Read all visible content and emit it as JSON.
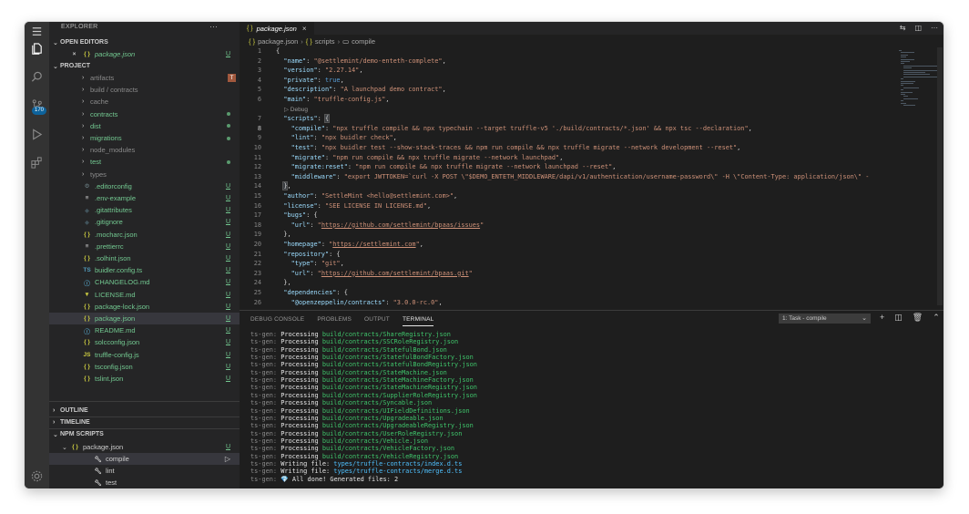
{
  "sidebar": {
    "title": "EXPLORER",
    "open_editors": {
      "label": "OPEN EDITORS",
      "files": [
        {
          "name": "package.json",
          "icon": "{ }",
          "status": "U"
        }
      ]
    },
    "project": {
      "label": "PROJECT",
      "items": [
        {
          "name": "artifacts",
          "kind": "folder",
          "status": "T",
          "color": "gray"
        },
        {
          "name": "build / contracts",
          "kind": "folder",
          "status": "",
          "color": "gray"
        },
        {
          "name": "cache",
          "kind": "folder",
          "status": "",
          "color": "gray"
        },
        {
          "name": "contracts",
          "kind": "folder",
          "status": "dot",
          "color": "green"
        },
        {
          "name": "dist",
          "kind": "folder",
          "status": "dot",
          "color": "green"
        },
        {
          "name": "migrations",
          "kind": "folder",
          "status": "dot",
          "color": "green"
        },
        {
          "name": "node_modules",
          "kind": "folder",
          "status": "",
          "color": "gray"
        },
        {
          "name": "test",
          "kind": "folder",
          "status": "dot",
          "color": "green"
        },
        {
          "name": "types",
          "kind": "folder",
          "status": "",
          "color": "gray"
        },
        {
          "name": ".editorconfig",
          "icon": "⚙",
          "status": "U",
          "color": "green",
          "iconColor": "#6d8086"
        },
        {
          "name": ".env-example",
          "icon": "≡",
          "status": "U",
          "color": "green",
          "iconColor": "#cccccc"
        },
        {
          "name": ".gitattributes",
          "icon": "◆",
          "status": "U",
          "color": "green",
          "iconColor": "#41535b"
        },
        {
          "name": ".gitignore",
          "icon": "◆",
          "status": "U",
          "color": "green",
          "iconColor": "#41535b"
        },
        {
          "name": ".mocharc.json",
          "icon": "{ }",
          "status": "U",
          "color": "green",
          "iconColor": "#cbcb41"
        },
        {
          "name": ".prettierrc",
          "icon": "≡",
          "status": "U",
          "color": "green",
          "iconColor": "#cccccc"
        },
        {
          "name": ".solhint.json",
          "icon": "{ }",
          "status": "U",
          "color": "green",
          "iconColor": "#cbcb41"
        },
        {
          "name": "buidler.config.ts",
          "icon": "TS",
          "status": "U",
          "color": "green",
          "iconColor": "#519aba"
        },
        {
          "name": "CHANGELOG.md",
          "icon": "ⓘ",
          "status": "U",
          "color": "green",
          "iconColor": "#519aba"
        },
        {
          "name": "LICENSE.md",
          "icon": "▼",
          "status": "U",
          "color": "green",
          "iconColor": "#cbcb41"
        },
        {
          "name": "package-lock.json",
          "icon": "{ }",
          "status": "U",
          "color": "green",
          "iconColor": "#cbcb41"
        },
        {
          "name": "package.json",
          "icon": "{ }",
          "status": "U",
          "color": "green",
          "iconColor": "#cbcb41",
          "selected": true
        },
        {
          "name": "README.md",
          "icon": "ⓘ",
          "status": "U",
          "color": "green",
          "iconColor": "#519aba"
        },
        {
          "name": "solcconfig.json",
          "icon": "{ }",
          "status": "U",
          "color": "green",
          "iconColor": "#cbcb41"
        },
        {
          "name": "truffle-config.js",
          "icon": "JS",
          "status": "U",
          "color": "green",
          "iconColor": "#cbcb41"
        },
        {
          "name": "tsconfig.json",
          "icon": "{ }",
          "status": "U",
          "color": "green",
          "iconColor": "#cbcb41"
        },
        {
          "name": "tslint.json",
          "icon": "{ }",
          "status": "U",
          "color": "green",
          "iconColor": "#cbcb41"
        }
      ]
    },
    "outline_label": "OUTLINE",
    "timeline_label": "TIMELINE",
    "npm_scripts": {
      "label": "NPM SCRIPTS",
      "file": "package.json",
      "file_status": "U",
      "scripts": [
        "compile",
        "lint",
        "test"
      ]
    },
    "scm_badge": "170"
  },
  "editor": {
    "tab_title": "package.json",
    "breadcrumb": [
      "package.json",
      "scripts",
      "compile"
    ],
    "debug_lens": "▷ Debug",
    "lines": [
      "{",
      "  \"name\": \"@settlemint/demo-enteth-complete\",",
      "  \"version\": \"2.27.14\",",
      "  \"private\": true,",
      "  \"description\": \"A launchpad demo contract\",",
      "  \"main\": \"truffle-config.js\",",
      "  \"scripts\": {",
      "    \"compile\": \"npx truffle compile && npx typechain --target truffle-v5 './build/contracts/*.json' && npx tsc --declaration\",",
      "    \"lint\": \"npx buidler check\",",
      "    \"test\": \"npx buidler test --show-stack-traces && npm run compile && npx truffle migrate --network development --reset\",",
      "    \"migrate\": \"npm run compile && npx truffle migrate --network launchpad\",",
      "    \"migrate:reset\": \"npm run compile && npx truffle migrate --network launchpad --reset\",",
      "    \"middleware\": \"export JWTTOKEN=`curl -X POST \\\"$DEMO_ENTETH_MIDDLEWARE/dapi/v1/authentication/username-password\\\" -H \\\"Content-Type: application/json\\\" -",
      "  },",
      "  \"author\": \"SettleMint <hello@settlemint.com>\",",
      "  \"license\": \"SEE LICENSE IN LICENSE.md\",",
      "  \"bugs\": {",
      "    \"url\": \"https://github.com/settlemint/bpaas/issues\"",
      "  },",
      "  \"homepage\": \"https://settlemint.com\",",
      "  \"repository\": {",
      "    \"type\": \"git\",",
      "    \"url\": \"https://github.com/settlemint/bpaas.git\"",
      "  },",
      "  \"dependencies\": {",
      "    \"@openzeppelin/contracts\": \"3.0.0-rc.0\","
    ],
    "current_line": 8
  },
  "panel": {
    "tabs": [
      "DEBUG CONSOLE",
      "PROBLEMS",
      "OUTPUT",
      "TERMINAL"
    ],
    "active_tab": "TERMINAL",
    "task_selector": "1: Task - compile",
    "terminal": [
      {
        "prefix": "ts-gen:",
        "verb": "Processing",
        "path": "build/contracts/ShareRegistry.json"
      },
      {
        "prefix": "ts-gen:",
        "verb": "Processing",
        "path": "build/contracts/SSCRoleRegistry.json"
      },
      {
        "prefix": "ts-gen:",
        "verb": "Processing",
        "path": "build/contracts/StatefulBond.json"
      },
      {
        "prefix": "ts-gen:",
        "verb": "Processing",
        "path": "build/contracts/StatefulBondFactory.json"
      },
      {
        "prefix": "ts-gen:",
        "verb": "Processing",
        "path": "build/contracts/StatefulBondRegistry.json"
      },
      {
        "prefix": "ts-gen:",
        "verb": "Processing",
        "path": "build/contracts/StateMachine.json"
      },
      {
        "prefix": "ts-gen:",
        "verb": "Processing",
        "path": "build/contracts/StateMachineFactory.json"
      },
      {
        "prefix": "ts-gen:",
        "verb": "Processing",
        "path": "build/contracts/StateMachineRegistry.json"
      },
      {
        "prefix": "ts-gen:",
        "verb": "Processing",
        "path": "build/contracts/SupplierRoleRegistry.json"
      },
      {
        "prefix": "ts-gen:",
        "verb": "Processing",
        "path": "build/contracts/Syncable.json"
      },
      {
        "prefix": "ts-gen:",
        "verb": "Processing",
        "path": "build/contracts/UIFieldDefinitions.json"
      },
      {
        "prefix": "ts-gen:",
        "verb": "Processing",
        "path": "build/contracts/Upgradeable.json"
      },
      {
        "prefix": "ts-gen:",
        "verb": "Processing",
        "path": "build/contracts/UpgradeableRegistry.json"
      },
      {
        "prefix": "ts-gen:",
        "verb": "Processing",
        "path": "build/contracts/UserRoleRegistry.json"
      },
      {
        "prefix": "ts-gen:",
        "verb": "Processing",
        "path": "build/contracts/Vehicle.json"
      },
      {
        "prefix": "ts-gen:",
        "verb": "Processing",
        "path": "build/contracts/VehicleFactory.json"
      },
      {
        "prefix": "ts-gen:",
        "verb": "Processing",
        "path": "build/contracts/VehicleRegistry.json"
      },
      {
        "prefix": "ts-gen:",
        "verb": "Writing file:",
        "path": "types/truffle-contracts/index.d.ts"
      },
      {
        "prefix": "ts-gen:",
        "verb": "Writing file:",
        "path": "types/truffle-contracts/merge.d.ts"
      },
      {
        "prefix": "ts-gen:",
        "verb": "💎 All done! Generated files: 2",
        "path": ""
      }
    ]
  },
  "icons": {
    "activity": [
      "files-icon",
      "search-icon",
      "source-control-icon",
      "run-debug-icon",
      "extensions-icon"
    ],
    "tab_actions": [
      "compare-icon",
      "split-editor-icon",
      "more-icon"
    ],
    "panel_actions": [
      "add-terminal-icon",
      "split-terminal-icon",
      "trash-icon",
      "maximize-icon",
      "close-icon"
    ]
  },
  "colors": {
    "accent": "#0e639c",
    "untracked": "#73c991",
    "terminal_green": "#3fc56b"
  }
}
